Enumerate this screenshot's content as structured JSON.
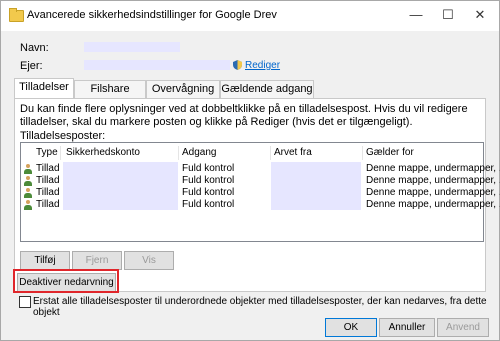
{
  "window": {
    "title": "Avancerede sikkerhedsindstillinger for Google Drev",
    "minimize": "—",
    "maximize": "☐",
    "close": "✕"
  },
  "owner_info": {
    "name_label": "Navn:",
    "owner_label": "Ejer:",
    "change_link": "Rediger"
  },
  "tabs": [
    {
      "label": "Tilladelser",
      "active": true
    },
    {
      "label": "Filshare",
      "active": false
    },
    {
      "label": "Overvågning",
      "active": false
    },
    {
      "label": "Gældende adgang",
      "active": false
    }
  ],
  "description": "Du kan finde flere oplysninger ved at dobbeltklikke på en tilladelsespost. Hvis du vil redigere tilladelser, skal du markere posten og klikke på Rediger (hvis det er tilgængeligt).",
  "entries_label": "Tilladelsesposter:",
  "columns": [
    "Type",
    "Sikkerhedskonto",
    "Adgang",
    "Arvet fra",
    "Gælder for"
  ],
  "rows": [
    {
      "type": "Tillad",
      "access": "Fuld kontrol",
      "applies": "Denne mappe, undermapper, ..."
    },
    {
      "type": "Tillad",
      "access": "Fuld kontrol",
      "applies": "Denne mappe, undermapper, ..."
    },
    {
      "type": "Tillad",
      "access": "Fuld kontrol",
      "applies": "Denne mappe, undermapper, ..."
    },
    {
      "type": "Tillad",
      "access": "Fuld kontrol",
      "applies": "Denne mappe, undermapper, ..."
    }
  ],
  "buttons": {
    "add": "Tilføj",
    "remove": "Fjern",
    "view": "Vis",
    "disable_inheritance": "Deaktiver nedarvning",
    "ok": "OK",
    "cancel": "Annuller",
    "apply": "Anvend"
  },
  "replace_checkbox_label": "Erstat alle tilladelsesposter til underordnede objekter med tilladelsesposter, der kan nedarves, fra dette objekt",
  "colors": {
    "highlight": "#e0262b",
    "link": "#0066cc",
    "redacted": "#e6e6ff"
  }
}
